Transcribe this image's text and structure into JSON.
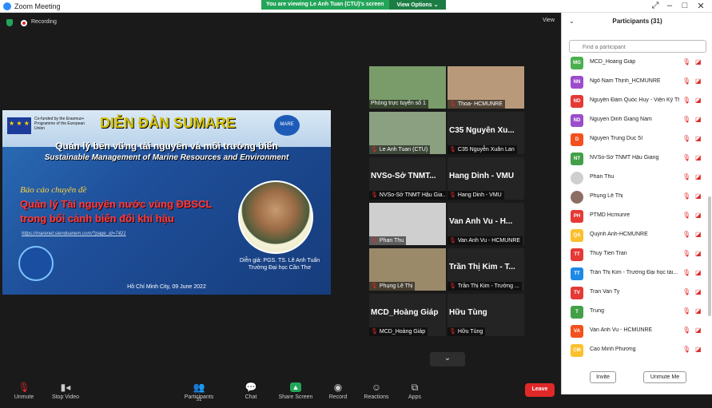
{
  "window": {
    "title": "Zoom Meeting",
    "minimize": "–",
    "maximize": "□",
    "close": "✕",
    "fullscreen": "⤢"
  },
  "banner": {
    "text": "You are viewing Le Anh Tuan (CTU)'s screen",
    "options": "View Options ⌄"
  },
  "status": {
    "recording": "Recording",
    "view": "View"
  },
  "slide": {
    "eu_text": "Co-funded by the Erasmus+ Programme of the European Union",
    "forum_title": "DIỄN ĐÀN SUMARE",
    "mare_logo": "MARE",
    "subtitle_vi": "Quản lý bền vững tài nguyên và môi trường biển",
    "subtitle_en": "Sustainable Management of Marine Resources and Environment",
    "report_label": "Báo cáo chuyên đề",
    "report_title_1": "Quản lý Tài nguyên nước vùng ĐBSCL",
    "report_title_2": "trong bối cảnh biến đổi khí hậu",
    "url": "https://marenet.siendoanem.com/?page_id=7421",
    "speaker_1": "Diễn giả: PGS. TS. Lê Anh Tuấn",
    "speaker_2": "Trường Đại học Cần Thơ",
    "place_date": "Hồ Chí Minh City, 09 June 2022"
  },
  "gallery": [
    {
      "name": "",
      "label": "Phòng trực tuyến số 1",
      "muted": false,
      "video": true,
      "color": "#7a9c6a"
    },
    {
      "name": "",
      "label": "Thoa- HCMUNRE",
      "muted": true,
      "video": true,
      "color": "#b89a7a"
    },
    {
      "name": "",
      "label": "Le Anh Tuan (CTU)",
      "muted": true,
      "video": true,
      "color": "#8aa080"
    },
    {
      "name": "C35 Nguyễn Xu...",
      "label": "C35 Nguyễn Xuân Lan",
      "muted": true,
      "video": false,
      "color": "#242424"
    },
    {
      "name": "NVSo-Sở TNMT...",
      "label": "NVSo-Sở TNMT Hậu Gia...",
      "muted": true,
      "video": false,
      "color": "#242424"
    },
    {
      "name": "Hang Dinh - VMU",
      "label": "Hang Dinh - VMU",
      "muted": true,
      "video": false,
      "color": "#242424"
    },
    {
      "name": "",
      "label": "Phan Thu",
      "muted": true,
      "video": true,
      "color": "#cfcfcf"
    },
    {
      "name": "Van Anh Vu - H...",
      "label": "Van Anh Vu - HCMUNRE",
      "muted": true,
      "video": false,
      "color": "#242424"
    },
    {
      "name": "",
      "label": "Phụng Lê Thị",
      "muted": true,
      "video": true,
      "color": "#9a8a6a"
    },
    {
      "name": "Trần Thị Kim - T...",
      "label": "Trần Thị Kim - Trường ...",
      "muted": true,
      "video": false,
      "color": "#242424"
    },
    {
      "name": "MCD_Hoàng Giáp",
      "label": "MCD_Hoàng Giáp",
      "muted": true,
      "video": false,
      "color": "#242424"
    },
    {
      "name": "Hữu Tùng",
      "label": "Hữu Tùng",
      "muted": true,
      "video": false,
      "color": "#242424"
    }
  ],
  "toolbar": {
    "unmute": "Unmute",
    "stop_video": "Stop Video",
    "participants": "Participants",
    "participants_count": "31",
    "chat": "Chat",
    "share_screen": "Share Screen",
    "record": "Record",
    "reactions": "Reactions",
    "apps": "Apps",
    "leave": "Leave"
  },
  "panel": {
    "title": "Participants (31)",
    "search_placeholder": "Find a participant",
    "participants": [
      {
        "initials": "MG",
        "name": "MCD_Hoang Giáp",
        "color": "#4caf50"
      },
      {
        "initials": "NN",
        "name": "Ngô Nam Thịnh_HCMUNRE",
        "color": "#9c4dcc"
      },
      {
        "initials": "ND",
        "name": "Nguyễn Đàm Quốc Huy - Viện Kỹ Th...",
        "color": "#e53935"
      },
      {
        "initials": "ND",
        "name": "Nguyen Dinh Giang Nam",
        "color": "#9c4dcc"
      },
      {
        "initials": "D",
        "name": "Nguyen Trung Duc 5I",
        "color": "#f4511e"
      },
      {
        "initials": "NT",
        "name": "NVSo-Sở TNMT Hậu Giang",
        "color": "#43a047"
      },
      {
        "initials": "",
        "name": "Phan Thu",
        "color": "#cfcfcf"
      },
      {
        "initials": "",
        "name": "Phụng Lê Thị",
        "color": "#8d6e63"
      },
      {
        "initials": "PH",
        "name": "PTMD Hcmunre",
        "color": "#e53935"
      },
      {
        "initials": "QA",
        "name": "Quỳnh Anh-HCMUNRE",
        "color": "#fbc02d"
      },
      {
        "initials": "TT",
        "name": "Thuy Tien Tran",
        "color": "#e53935"
      },
      {
        "initials": "TT",
        "name": "Trần Thị Kim - Trường Đại học tài...",
        "color": "#1e88e5"
      },
      {
        "initials": "TV",
        "name": "Tran Van Ty",
        "color": "#e53935"
      },
      {
        "initials": "T",
        "name": "Trung",
        "color": "#43a047"
      },
      {
        "initials": "VA",
        "name": "Van Anh Vu - HCMUNRE",
        "color": "#f4511e"
      },
      {
        "initials": "CM",
        "name": "Cao Minh Phương",
        "color": "#fbc02d"
      }
    ],
    "invite": "Invite",
    "mute_me": "Unmute Me"
  }
}
